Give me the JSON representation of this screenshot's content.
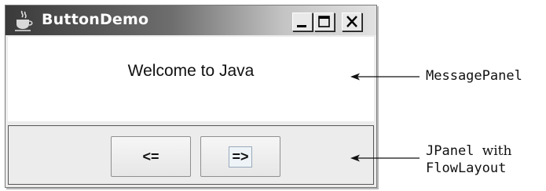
{
  "window": {
    "title": "ButtonDemo",
    "controls": {
      "minimize": "minimize",
      "maximize": "maximize",
      "close": "close"
    }
  },
  "message_panel": {
    "text": "Welcome to Java"
  },
  "buttons": {
    "left_label": "<=",
    "right_label": "=>"
  },
  "annotations": {
    "message_panel": "MessagePanel",
    "button_panel_line1_code": "JPanel",
    "button_panel_line1_word": "with",
    "button_panel_line2": "FlowLayout"
  },
  "icons": {
    "app": "java-coffee-icon",
    "minimize": "minimize-icon",
    "maximize": "maximize-icon",
    "close": "close-icon"
  }
}
